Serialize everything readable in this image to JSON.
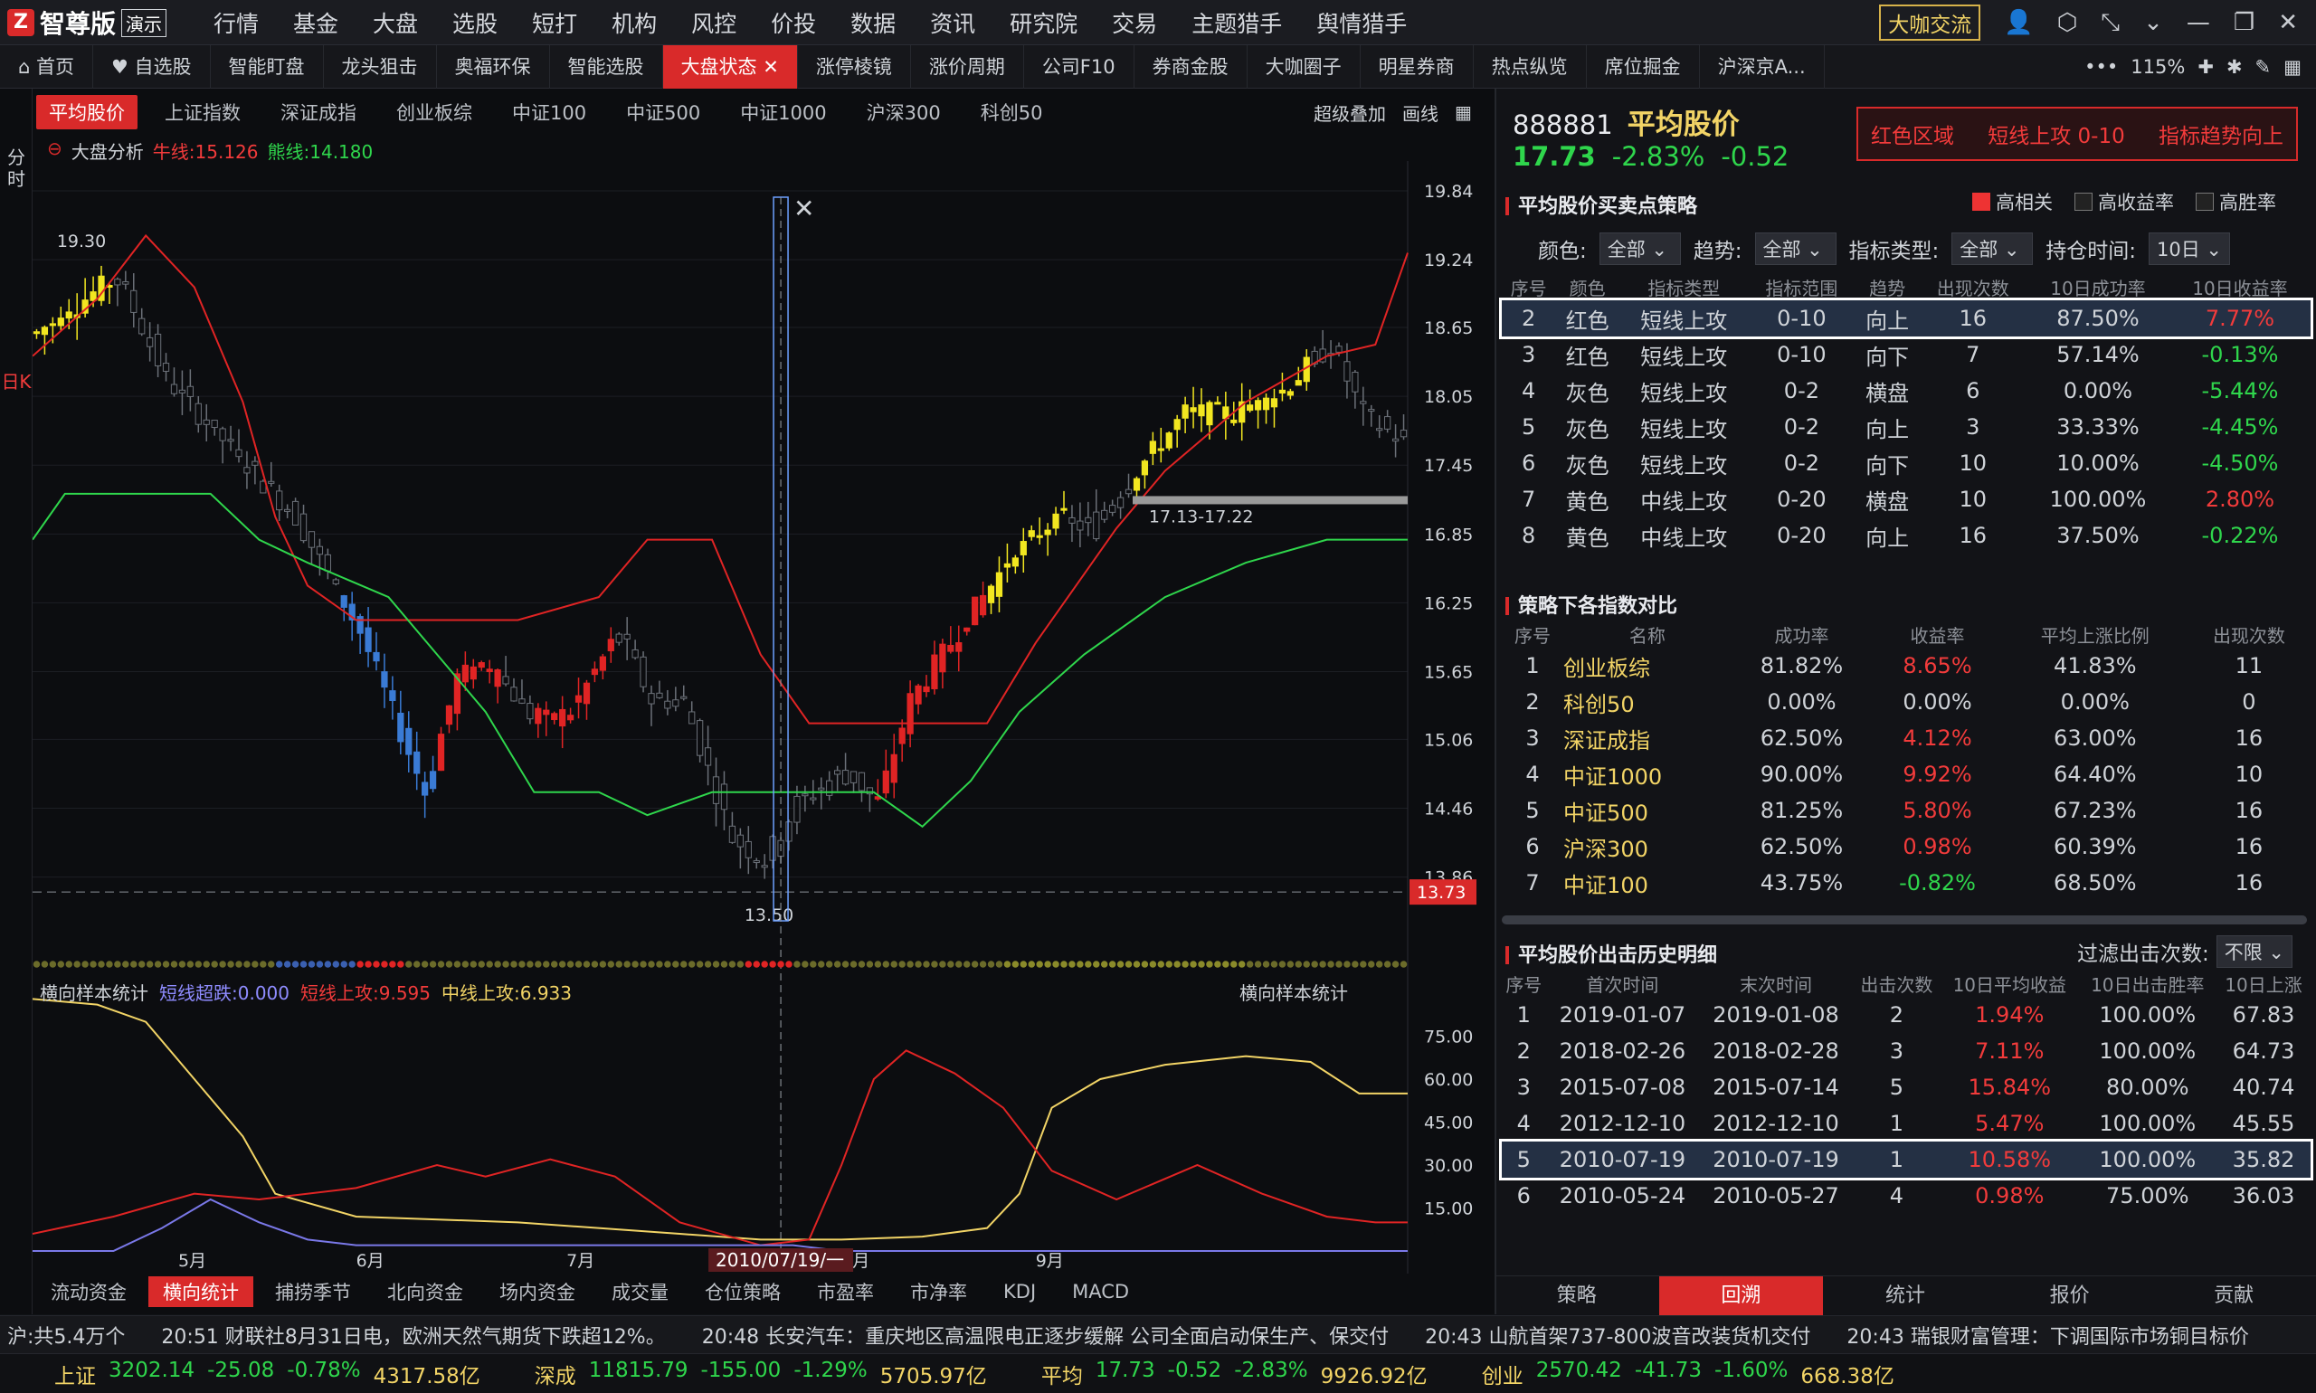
{
  "app": {
    "name": "智尊版",
    "demo": "演示",
    "logo": "Z"
  },
  "menu": [
    "行情",
    "基金",
    "大盘",
    "选股",
    "短打",
    "机构",
    "风控",
    "价投",
    "数据",
    "资讯",
    "研究院",
    "交易",
    "主题猎手",
    "舆情猎手"
  ],
  "top_right": {
    "daka": "大咖交流",
    "zoom": "115%"
  },
  "tabs": [
    {
      "label": "首页",
      "icon": "home-icon"
    },
    {
      "label": "自选股",
      "icon": "heart-icon"
    },
    {
      "label": "智能盯盘"
    },
    {
      "label": "龙头狙击"
    },
    {
      "label": "奥福环保"
    },
    {
      "label": "智能选股"
    },
    {
      "label": "大盘状态",
      "active": true
    },
    {
      "label": "涨停棱镜"
    },
    {
      "label": "涨价周期"
    },
    {
      "label": "公司F10"
    },
    {
      "label": "券商金股"
    },
    {
      "label": "大咖圈子"
    },
    {
      "label": "明星券商"
    },
    {
      "label": "热点纵览"
    },
    {
      "label": "席位掘金"
    },
    {
      "label": "沪深京A..."
    }
  ],
  "sidebar": {
    "top": "分时",
    "bottom": "日K"
  },
  "index_tabs": [
    "平均股价",
    "上证指数",
    "深证成指",
    "创业板综",
    "中证100",
    "中证500",
    "中证1000",
    "沪深300",
    "科创50"
  ],
  "chart_tools": [
    "超级叠加",
    "画线"
  ],
  "main_chart": {
    "legend": {
      "title": "大盘分析",
      "bull_label": "牛线:",
      "bull": "15.126",
      "bear_label": "熊线:",
      "bear": "14.180"
    },
    "y_ticks": [
      "19.84",
      "19.24",
      "18.65",
      "18.05",
      "17.45",
      "16.85",
      "16.25",
      "15.65",
      "15.06",
      "14.46",
      "13.86"
    ],
    "current_price": "13.73",
    "annotations": [
      "19.30",
      "13.50",
      "17.13-17.22"
    ],
    "x_labels": [
      "5月",
      "6月",
      "7月",
      "8月",
      "9月"
    ],
    "crosshair_date": "2010/07/19/一"
  },
  "sub_chart": {
    "title": "横向样本统计",
    "legend": [
      {
        "label": "短线超跌:0.000",
        "color": "#8f8cff"
      },
      {
        "label": "短线上攻:9.595",
        "color": "#f23b3b"
      },
      {
        "label": "中线上攻:6.933",
        "color": "#f2d466"
      }
    ],
    "y_ticks": [
      "75.00",
      "60.00",
      "45.00",
      "30.00",
      "15.00"
    ]
  },
  "bottom_tabs": [
    "流动资金",
    "横向统计",
    "捕捞季节",
    "北向资金",
    "场内资金",
    "成交量",
    "仓位策略",
    "市盈率",
    "市净率",
    "KDJ",
    "MACD"
  ],
  "stock": {
    "code": "888881",
    "name": "平均股价",
    "price": "17.73",
    "pct": "-2.83%",
    "chg": "-0.52"
  },
  "alarm": {
    "zone": "红色区域",
    "signal": "短线上攻 0-10",
    "trend": "指标趋势向上"
  },
  "strategy": {
    "title": "平均股价买卖点策略",
    "checks": [
      {
        "label": "高相关",
        "on": true
      },
      {
        "label": "高收益率",
        "on": false
      },
      {
        "label": "高胜率",
        "on": false
      }
    ],
    "filters": [
      {
        "label": "颜色:",
        "value": "全部"
      },
      {
        "label": "趋势:",
        "value": "全部"
      },
      {
        "label": "指标类型:",
        "value": "全部"
      },
      {
        "label": "持仓时间:",
        "value": "10日"
      }
    ],
    "headers": [
      "序号",
      "颜色",
      "指标类型",
      "指标范围",
      "趋势",
      "出现次数",
      "10日成功率",
      "10日收益率"
    ],
    "rows": [
      [
        "2",
        "红色",
        "短线上攻",
        "0-10",
        "向上",
        "16",
        "87.50%",
        "7.77%"
      ],
      [
        "3",
        "红色",
        "短线上攻",
        "0-10",
        "向下",
        "7",
        "57.14%",
        "-0.13%"
      ],
      [
        "4",
        "灰色",
        "短线上攻",
        "0-2",
        "横盘",
        "6",
        "0.00%",
        "-5.44%"
      ],
      [
        "5",
        "灰色",
        "短线上攻",
        "0-2",
        "向上",
        "3",
        "33.33%",
        "-4.45%"
      ],
      [
        "6",
        "灰色",
        "短线上攻",
        "0-2",
        "向下",
        "10",
        "10.00%",
        "-4.50%"
      ],
      [
        "7",
        "黄色",
        "中线上攻",
        "0-20",
        "横盘",
        "10",
        "100.00%",
        "2.80%"
      ],
      [
        "8",
        "黄色",
        "中线上攻",
        "0-20",
        "向上",
        "16",
        "37.50%",
        "-0.22%"
      ]
    ]
  },
  "compare": {
    "title": "策略下各指数对比",
    "headers": [
      "序号",
      "名称",
      "成功率",
      "收益率",
      "平均上涨比例",
      "出现次数"
    ],
    "rows": [
      [
        "1",
        "创业板综",
        "81.82%",
        "8.65%",
        "41.83%",
        "11"
      ],
      [
        "2",
        "科创50",
        "0.00%",
        "0.00%",
        "0.00%",
        "0"
      ],
      [
        "3",
        "深证成指",
        "62.50%",
        "4.12%",
        "63.00%",
        "16"
      ],
      [
        "4",
        "中证1000",
        "90.00%",
        "9.92%",
        "64.40%",
        "10"
      ],
      [
        "5",
        "中证500",
        "81.25%",
        "5.80%",
        "67.23%",
        "16"
      ],
      [
        "6",
        "沪深300",
        "62.50%",
        "0.98%",
        "60.39%",
        "16"
      ],
      [
        "7",
        "中证100",
        "43.75%",
        "-0.82%",
        "68.50%",
        "16"
      ]
    ]
  },
  "history": {
    "title": "平均股价出击历史明细",
    "filter_label": "过滤出击次数:",
    "filter_value": "不限",
    "headers": [
      "序号",
      "首次时间",
      "末次时间",
      "出击次数",
      "10日平均收益",
      "10日出击胜率",
      "10日上涨"
    ],
    "rows": [
      [
        "1",
        "2019-01-07",
        "2019-01-08",
        "2",
        "1.94%",
        "100.00%",
        "67.83"
      ],
      [
        "2",
        "2018-02-26",
        "2018-02-28",
        "3",
        "7.11%",
        "100.00%",
        "64.73"
      ],
      [
        "3",
        "2015-07-08",
        "2015-07-14",
        "5",
        "15.84%",
        "80.00%",
        "40.74"
      ],
      [
        "4",
        "2012-12-10",
        "2012-12-10",
        "1",
        "5.47%",
        "100.00%",
        "45.55"
      ],
      [
        "5",
        "2010-07-19",
        "2010-07-19",
        "1",
        "10.58%",
        "100.00%",
        "35.82"
      ],
      [
        "6",
        "2010-05-24",
        "2010-05-27",
        "4",
        "0.98%",
        "75.00%",
        "36.03"
      ]
    ]
  },
  "right_tabs": [
    "策略",
    "回溯",
    "统计",
    "报价",
    "贡献"
  ],
  "news": [
    "沪:共5.4万个",
    "20:51 财联社8月31日电，欧洲天然气期货下跌超12%。",
    "20:48 长安汽车：重庆地区高温限电正逐步缓解 公司全面启动保生产、保交付",
    "20:43 山航首架737-800波音改装货机交付",
    "20:43 瑞银财富管理：下调国际市场铜目标价"
  ],
  "status": [
    {
      "name": "上证",
      "val": "3202.14",
      "chg": "-25.08",
      "pct": "-0.78%",
      "amt": "4317.58亿"
    },
    {
      "name": "深成",
      "val": "11815.79",
      "chg": "-155.00",
      "pct": "-1.29%",
      "amt": "5705.97亿"
    },
    {
      "name": "平均",
      "val": "17.73",
      "chg": "-0.52",
      "pct": "-2.83%",
      "amt": "9926.92亿"
    },
    {
      "name": "创业",
      "val": "2570.42",
      "chg": "-41.73",
      "pct": "-1.60%",
      "amt": "668.38亿"
    }
  ],
  "colors": {
    "accent": "#d92a2a",
    "up": "#f23b3b",
    "down": "#2fd64c",
    "yellow": "#f2d466",
    "blue": "#3a7bd5"
  }
}
